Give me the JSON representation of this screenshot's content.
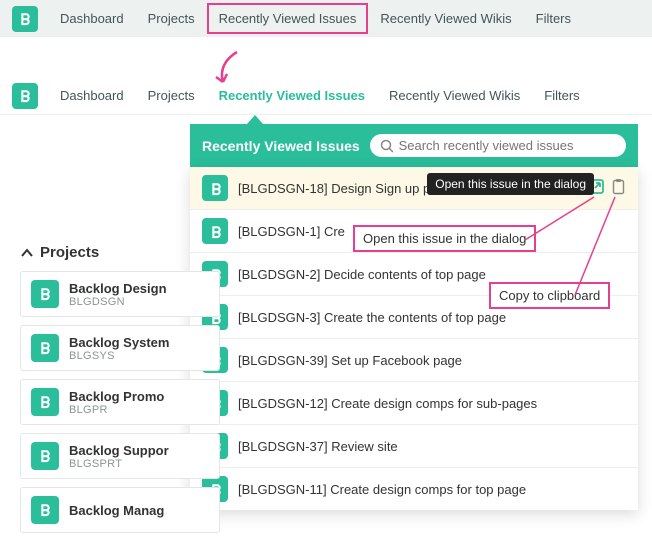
{
  "topbar": {
    "items": [
      "Dashboard",
      "Projects",
      "Recently Viewed Issues",
      "Recently Viewed Wikis",
      "Filters"
    ],
    "highlight_index": 2
  },
  "mainnav": {
    "items": [
      "Dashboard",
      "Projects",
      "Recently Viewed Issues",
      "Recently Viewed Wikis",
      "Filters"
    ],
    "active_index": 2
  },
  "panel": {
    "title": "Recently Viewed Issues",
    "search_placeholder": "Search recently viewed issues",
    "tooltip": "Open this issue in the dialog"
  },
  "issues": [
    {
      "label": "[BLGDSGN-18] Design Sign up p",
      "hl": true,
      "show_actions": true
    },
    {
      "label": "[BLGDSGN-1] Cre"
    },
    {
      "label": "[BLGDSGN-2] Decide contents of top page"
    },
    {
      "label": "[BLGDSGN-3] Create the contents of top page"
    },
    {
      "label": "[BLGDSGN-39] Set up Facebook page"
    },
    {
      "label": "[BLGDSGN-12] Create design comps for sub-pages"
    },
    {
      "label": "[BLGDSGN-37] Review site"
    },
    {
      "label": "[BLGDSGN-11] Create design comps for top page"
    }
  ],
  "sidebar": {
    "title": "Projects",
    "projects": [
      {
        "name": "Backlog Design",
        "key": "BLGDSGN"
      },
      {
        "name": "Backlog System",
        "key": "BLGSYS"
      },
      {
        "name": "Backlog Promo",
        "key": "BLGPR"
      },
      {
        "name": "Backlog Suppor",
        "key": "BLGSPRT"
      },
      {
        "name": "Backlog Manag",
        "key": ""
      }
    ]
  },
  "callouts": {
    "open_dialog": "Open this issue in the dialog",
    "copy": "Copy to clipboard"
  },
  "colors": {
    "brand": "#2bbe9b",
    "accent": "#e63f8d"
  }
}
